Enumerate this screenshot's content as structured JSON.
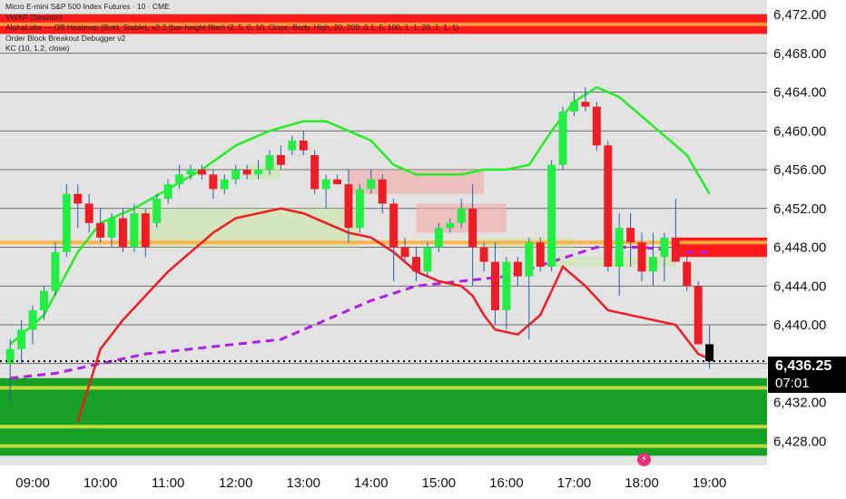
{
  "legend": {
    "title": "Micro E-mini S&P 500 Index Futures · 10 · CME",
    "vwap": "VWAP (Session)",
    "indicator1": "AlphaLabs — OB Heatmap (Bold, Stable), v2.3 (bar-height filter) (2, 5, 0, 10, Close, Body, High, 20, 200, 0.1, 5, 100, 1, 1, 20, 1, 1, 1)",
    "indicator2": "Order Block Breakout Debugger v2",
    "indicator3": "KC (10, 1.2, close)"
  },
  "price_tag": {
    "price": "6,436.25",
    "countdown": "07:01"
  },
  "colors": {
    "up": "#22ee44",
    "down": "#ee1c24",
    "neutral": "#000000",
    "kc_upper": "#22ee22",
    "kc_lower": "#ee1c24",
    "vwap": "#b020e0",
    "demand_zone": "#16a024",
    "supply_zone": "#ff1a1a",
    "zone_line": "#c8e040",
    "grid": "#444444"
  },
  "chart_data": {
    "type": "candlestick",
    "y_axis": {
      "range": [
        6425.5,
        6473.5
      ],
      "ticks": [
        6428,
        6432,
        6436,
        6440,
        6444,
        6448,
        6452,
        6456,
        6460,
        6464,
        6468,
        6472
      ],
      "tick_labels": [
        "6,428.00",
        "6,432.00",
        "6,436.00",
        "6,440.00",
        "6,444.00",
        "6,448.00",
        "6,452.00",
        "6,456.00",
        "6,460.00",
        "6,464.00",
        "6,468.00",
        "6,472.00"
      ]
    },
    "x_axis": {
      "range": [
        "08:31",
        "19:51"
      ],
      "ticks": [
        "09:00",
        "10:00",
        "11:00",
        "12:00",
        "13:00",
        "14:00",
        "15:00",
        "16:00",
        "17:00",
        "18:00",
        "19:00"
      ]
    },
    "last_price": 6436.25,
    "candles": [
      {
        "t": "08:40",
        "o": 6436.0,
        "h": 6438.5,
        "l": 6432.0,
        "c": 6437.5
      },
      {
        "t": "08:50",
        "o": 6437.5,
        "h": 6440.5,
        "l": 6436.0,
        "c": 6439.5
      },
      {
        "t": "09:00",
        "o": 6439.5,
        "h": 6442.0,
        "l": 6438.0,
        "c": 6441.5
      },
      {
        "t": "09:10",
        "o": 6441.5,
        "h": 6444.0,
        "l": 6440.5,
        "c": 6443.5
      },
      {
        "t": "09:20",
        "o": 6443.5,
        "h": 6448.5,
        "l": 6443.0,
        "c": 6447.5
      },
      {
        "t": "09:30",
        "o": 6447.5,
        "h": 6454.5,
        "l": 6447.0,
        "c": 6453.5
      },
      {
        "t": "09:40",
        "o": 6453.5,
        "h": 6454.5,
        "l": 6450.0,
        "c": 6452.5
      },
      {
        "t": "09:50",
        "o": 6452.5,
        "h": 6453.5,
        "l": 6449.5,
        "c": 6450.5
      },
      {
        "t": "10:00",
        "o": 6450.5,
        "h": 6452.0,
        "l": 6448.5,
        "c": 6449.0
      },
      {
        "t": "10:10",
        "o": 6449.0,
        "h": 6451.5,
        "l": 6448.0,
        "c": 6451.0
      },
      {
        "t": "10:20",
        "o": 6451.0,
        "h": 6452.0,
        "l": 6447.5,
        "c": 6448.0
      },
      {
        "t": "10:30",
        "o": 6448.0,
        "h": 6452.5,
        "l": 6447.5,
        "c": 6451.5
      },
      {
        "t": "10:40",
        "o": 6451.5,
        "h": 6452.0,
        "l": 6447.0,
        "c": 6448.0
      },
      {
        "t": "10:50",
        "o": 6450.5,
        "h": 6453.5,
        "l": 6450.0,
        "c": 6453.0
      },
      {
        "t": "11:00",
        "o": 6453.0,
        "h": 6455.0,
        "l": 6452.5,
        "c": 6454.5
      },
      {
        "t": "11:10",
        "o": 6454.5,
        "h": 6456.5,
        "l": 6454.0,
        "c": 6455.5
      },
      {
        "t": "11:20",
        "o": 6455.5,
        "h": 6456.5,
        "l": 6455.0,
        "c": 6456.0
      },
      {
        "t": "11:30",
        "o": 6456.0,
        "h": 6456.5,
        "l": 6455.0,
        "c": 6455.5
      },
      {
        "t": "11:40",
        "o": 6455.5,
        "h": 6456.0,
        "l": 6453.0,
        "c": 6454.0
      },
      {
        "t": "11:50",
        "o": 6454.0,
        "h": 6455.5,
        "l": 6453.5,
        "c": 6455.0
      },
      {
        "t": "12:00",
        "o": 6455.0,
        "h": 6456.5,
        "l": 6454.5,
        "c": 6456.0
      },
      {
        "t": "12:10",
        "o": 6456.0,
        "h": 6456.5,
        "l": 6455.0,
        "c": 6455.5
      },
      {
        "t": "12:20",
        "o": 6455.5,
        "h": 6457.0,
        "l": 6455.0,
        "c": 6456.0
      },
      {
        "t": "12:30",
        "o": 6456.0,
        "h": 6458.0,
        "l": 6455.5,
        "c": 6457.5
      },
      {
        "t": "12:40",
        "o": 6457.5,
        "h": 6458.5,
        "l": 6456.0,
        "c": 6456.5
      },
      {
        "t": "12:50",
        "o": 6458.0,
        "h": 6459.5,
        "l": 6457.5,
        "c": 6459.0
      },
      {
        "t": "13:00",
        "o": 6459.0,
        "h": 6460.0,
        "l": 6457.5,
        "c": 6458.0
      },
      {
        "t": "13:10",
        "o": 6457.5,
        "h": 6458.0,
        "l": 6453.5,
        "c": 6454.0
      },
      {
        "t": "13:20",
        "o": 6454.0,
        "h": 6455.5,
        "l": 6452.0,
        "c": 6455.0
      },
      {
        "t": "13:30",
        "o": 6455.0,
        "h": 6455.5,
        "l": 6454.5,
        "c": 6454.5
      },
      {
        "t": "13:40",
        "o": 6454.5,
        "h": 6456.0,
        "l": 6448.5,
        "c": 6450.0
      },
      {
        "t": "13:50",
        "o": 6450.0,
        "h": 6454.5,
        "l": 6449.5,
        "c": 6454.0
      },
      {
        "t": "14:00",
        "o": 6454.0,
        "h": 6456.0,
        "l": 6453.5,
        "c": 6455.0
      },
      {
        "t": "14:10",
        "o": 6455.0,
        "h": 6455.5,
        "l": 6451.5,
        "c": 6452.5
      },
      {
        "t": "14:20",
        "o": 6452.5,
        "h": 6453.0,
        "l": 6444.5,
        "c": 6448.0
      },
      {
        "t": "14:30",
        "o": 6448.0,
        "h": 6449.0,
        "l": 6446.5,
        "c": 6447.0
      },
      {
        "t": "14:40",
        "o": 6447.0,
        "h": 6448.0,
        "l": 6444.5,
        "c": 6445.5
      },
      {
        "t": "14:50",
        "o": 6445.5,
        "h": 6448.5,
        "l": 6445.0,
        "c": 6448.0
      },
      {
        "t": "15:00",
        "o": 6448.0,
        "h": 6450.5,
        "l": 6447.5,
        "c": 6450.0
      },
      {
        "t": "15:10",
        "o": 6450.0,
        "h": 6451.0,
        "l": 6449.5,
        "c": 6450.5
      },
      {
        "t": "15:20",
        "o": 6450.5,
        "h": 6453.0,
        "l": 6450.0,
        "c": 6452.0
      },
      {
        "t": "15:30",
        "o": 6452.0,
        "h": 6454.5,
        "l": 6444.0,
        "c": 6448.0
      },
      {
        "t": "15:40",
        "o": 6448.0,
        "h": 6448.5,
        "l": 6445.5,
        "c": 6446.5
      },
      {
        "t": "15:50",
        "o": 6446.5,
        "h": 6448.5,
        "l": 6440.0,
        "c": 6441.5
      },
      {
        "t": "16:00",
        "o": 6441.5,
        "h": 6447.0,
        "l": 6439.5,
        "c": 6446.5
      },
      {
        "t": "16:10",
        "o": 6446.5,
        "h": 6447.0,
        "l": 6444.0,
        "c": 6445.0
      },
      {
        "t": "16:20",
        "o": 6445.0,
        "h": 6449.0,
        "l": 6438.5,
        "c": 6448.5
      },
      {
        "t": "16:30",
        "o": 6448.5,
        "h": 6449.0,
        "l": 6445.5,
        "c": 6446.0
      },
      {
        "t": "16:40",
        "o": 6446.0,
        "h": 6457.0,
        "l": 6445.5,
        "c": 6456.5
      },
      {
        "t": "16:50",
        "o": 6456.5,
        "h": 6462.5,
        "l": 6456.0,
        "c": 6462.0
      },
      {
        "t": "17:00",
        "o": 6462.0,
        "h": 6464.0,
        "l": 6461.5,
        "c": 6463.0
      },
      {
        "t": "17:10",
        "o": 6463.0,
        "h": 6464.5,
        "l": 6462.0,
        "c": 6462.5
      },
      {
        "t": "17:20",
        "o": 6462.5,
        "h": 6463.0,
        "l": 6458.0,
        "c": 6458.5
      },
      {
        "t": "17:30",
        "o": 6458.5,
        "h": 6459.0,
        "l": 6445.5,
        "c": 6446.0
      },
      {
        "t": "17:40",
        "o": 6446.0,
        "h": 6451.5,
        "l": 6443.0,
        "c": 6450.0
      },
      {
        "t": "17:50",
        "o": 6450.0,
        "h": 6451.5,
        "l": 6446.0,
        "c": 6448.5
      },
      {
        "t": "18:00",
        "o": 6448.5,
        "h": 6449.5,
        "l": 6444.5,
        "c": 6445.5
      },
      {
        "t": "18:10",
        "o": 6445.5,
        "h": 6449.5,
        "l": 6444.0,
        "c": 6447.0
      },
      {
        "t": "18:20",
        "o": 6447.0,
        "h": 6449.5,
        "l": 6444.5,
        "c": 6449.0
      },
      {
        "t": "18:30",
        "o": 6449.0,
        "h": 6453.0,
        "l": 6447.0,
        "c": 6446.5
      },
      {
        "t": "18:40",
        "o": 6446.5,
        "h": 6447.0,
        "l": 6443.5,
        "c": 6444.0
      },
      {
        "t": "18:50",
        "o": 6444.0,
        "h": 6444.5,
        "l": 6440.0,
        "c": 6438.0
      },
      {
        "t": "19:00",
        "o": 6438.0,
        "h": 6440.0,
        "l": 6435.5,
        "c": 6436.25
      }
    ],
    "kc_upper": [
      {
        "t": "08:40",
        "v": 6438.0
      },
      {
        "t": "09:10",
        "v": 6441.0
      },
      {
        "t": "09:40",
        "v": 6447.5
      },
      {
        "t": "10:00",
        "v": 6450.5
      },
      {
        "t": "10:30",
        "v": 6452.0
      },
      {
        "t": "11:00",
        "v": 6454.0
      },
      {
        "t": "11:30",
        "v": 6456.0
      },
      {
        "t": "12:00",
        "v": 6458.5
      },
      {
        "t": "12:30",
        "v": 6460.0
      },
      {
        "t": "13:00",
        "v": 6461.0
      },
      {
        "t": "13:20",
        "v": 6461.0
      },
      {
        "t": "13:40",
        "v": 6460.0
      },
      {
        "t": "14:00",
        "v": 6459.0
      },
      {
        "t": "14:20",
        "v": 6456.5
      },
      {
        "t": "14:40",
        "v": 6455.5
      },
      {
        "t": "15:00",
        "v": 6455.5
      },
      {
        "t": "15:20",
        "v": 6455.5
      },
      {
        "t": "15:40",
        "v": 6456.0
      },
      {
        "t": "16:00",
        "v": 6456.0
      },
      {
        "t": "16:20",
        "v": 6456.5
      },
      {
        "t": "16:40",
        "v": 6460.0
      },
      {
        "t": "17:00",
        "v": 6463.0
      },
      {
        "t": "17:20",
        "v": 6464.5
      },
      {
        "t": "17:40",
        "v": 6463.5
      },
      {
        "t": "18:00",
        "v": 6461.5
      },
      {
        "t": "18:20",
        "v": 6459.5
      },
      {
        "t": "18:40",
        "v": 6457.5
      },
      {
        "t": "19:00",
        "v": 6453.5
      }
    ],
    "kc_lower": [
      {
        "t": "09:40",
        "v": 6430.0
      },
      {
        "t": "10:00",
        "v": 6437.5
      },
      {
        "t": "10:20",
        "v": 6440.5
      },
      {
        "t": "10:40",
        "v": 6443.0
      },
      {
        "t": "11:00",
        "v": 6445.5
      },
      {
        "t": "11:20",
        "v": 6447.5
      },
      {
        "t": "11:40",
        "v": 6449.5
      },
      {
        "t": "12:00",
        "v": 6451.0
      },
      {
        "t": "12:20",
        "v": 6451.5
      },
      {
        "t": "12:40",
        "v": 6452.0
      },
      {
        "t": "13:00",
        "v": 6451.5
      },
      {
        "t": "13:20",
        "v": 6450.5
      },
      {
        "t": "13:40",
        "v": 6449.5
      },
      {
        "t": "14:00",
        "v": 6449.0
      },
      {
        "t": "14:20",
        "v": 6447.5
      },
      {
        "t": "14:40",
        "v": 6445.5
      },
      {
        "t": "15:00",
        "v": 6444.5
      },
      {
        "t": "15:20",
        "v": 6444.0
      },
      {
        "t": "15:30",
        "v": 6443.0
      },
      {
        "t": "15:40",
        "v": 6441.0
      },
      {
        "t": "15:50",
        "v": 6439.5
      },
      {
        "t": "16:10",
        "v": 6439.0
      },
      {
        "t": "16:30",
        "v": 6441.0
      },
      {
        "t": "16:40",
        "v": 6443.5
      },
      {
        "t": "16:50",
        "v": 6446.0
      },
      {
        "t": "17:10",
        "v": 6444.0
      },
      {
        "t": "17:30",
        "v": 6441.5
      },
      {
        "t": "17:50",
        "v": 6441.0
      },
      {
        "t": "18:10",
        "v": 6440.5
      },
      {
        "t": "18:30",
        "v": 6440.0
      },
      {
        "t": "18:50",
        "v": 6437.0
      },
      {
        "t": "19:00",
        "v": 6436.5
      }
    ],
    "vwap": [
      {
        "t": "08:40",
        "v": 6434.5
      },
      {
        "t": "09:20",
        "v": 6435.0
      },
      {
        "t": "10:00",
        "v": 6436.0
      },
      {
        "t": "10:40",
        "v": 6437.0
      },
      {
        "t": "11:20",
        "v": 6437.5
      },
      {
        "t": "12:00",
        "v": 6438.0
      },
      {
        "t": "12:40",
        "v": 6438.5
      },
      {
        "t": "13:20",
        "v": 6440.5
      },
      {
        "t": "14:00",
        "v": 6442.5
      },
      {
        "t": "14:40",
        "v": 6444.0
      },
      {
        "t": "15:20",
        "v": 6444.5
      },
      {
        "t": "16:00",
        "v": 6445.0
      },
      {
        "t": "16:40",
        "v": 6446.5
      },
      {
        "t": "17:20",
        "v": 6448.0
      },
      {
        "t": "18:00",
        "v": 6448.0
      },
      {
        "t": "18:40",
        "v": 6447.5
      },
      {
        "t": "19:00",
        "v": 6447.5
      }
    ],
    "demand_zones": [
      {
        "t0": "08:31",
        "t1": "19:51",
        "low": 6426.5,
        "high": 6434.5
      },
      {
        "t0": "10:30",
        "t1": "13:50",
        "low": 6448.0,
        "high": 6452.0
      },
      {
        "t0": "12:10",
        "t1": "12:40",
        "low": 6455.0,
        "high": 6456.5
      },
      {
        "t0": "15:30",
        "t1": "17:00",
        "low": 6448.0,
        "high": 6449.0
      },
      {
        "t0": "16:40",
        "t1": "18:30",
        "low": 6446.0,
        "high": 6447.0
      }
    ],
    "supply_zones": [
      {
        "t0": "08:31",
        "t1": "19:51",
        "low": 6470.0,
        "high": 6472.0
      },
      {
        "t0": "18:30",
        "t1": "19:51",
        "low": 6447.0,
        "high": 6449.0
      },
      {
        "t0": "13:40",
        "t1": "15:40",
        "low": 6453.5,
        "high": 6456.0
      },
      {
        "t0": "14:40",
        "t1": "16:00",
        "low": 6449.5,
        "high": 6452.5
      }
    ],
    "zone_lines": [
      6433.5,
      6429.5,
      6427.5,
      6448.5,
      6471.0
    ]
  }
}
